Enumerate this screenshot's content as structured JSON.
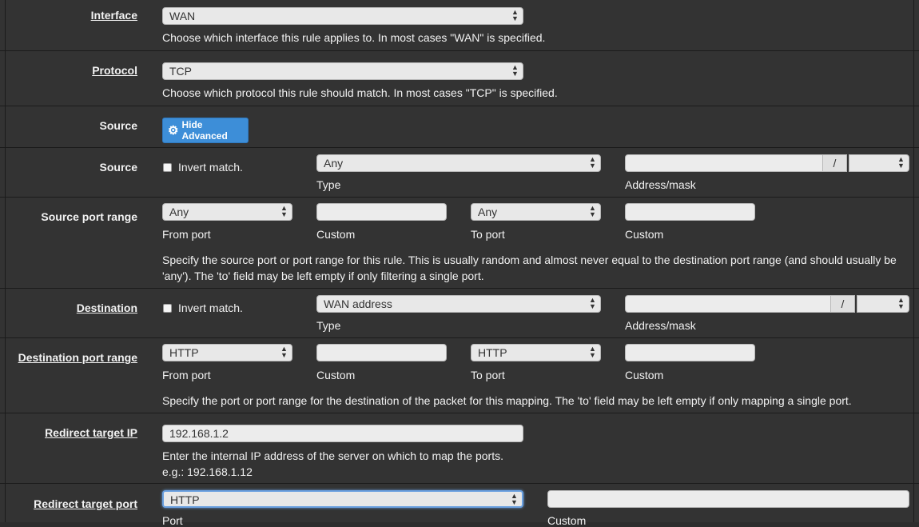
{
  "interface": {
    "label": "Interface",
    "value": "WAN",
    "help": "Choose which interface this rule applies to. In most cases \"WAN\" is specified."
  },
  "protocol": {
    "label": "Protocol",
    "value": "TCP",
    "help": "Choose which protocol this rule should match. In most cases \"TCP\" is specified."
  },
  "source_advanced": {
    "label": "Source",
    "button_label": "Hide Advanced",
    "button_icon": "gear-icon"
  },
  "source": {
    "label": "Source",
    "invert_label": "Invert match.",
    "invert_checked": false,
    "type_value": "Any",
    "type_label": "Type",
    "address_value": "",
    "slash": "/",
    "mask_value": "",
    "address_label": "Address/mask"
  },
  "source_port_range": {
    "label": "Source port range",
    "from_value": "Any",
    "from_label": "From port",
    "from_custom_value": "",
    "from_custom_label": "Custom",
    "to_value": "Any",
    "to_label": "To port",
    "to_custom_value": "",
    "to_custom_label": "Custom",
    "help": "Specify the source port or port range for this rule. This is usually random and almost never equal to the destination port range (and should usually be 'any'). The 'to' field may be left empty if only filtering a single port."
  },
  "destination": {
    "label": "Destination",
    "invert_label": "Invert match.",
    "invert_checked": false,
    "type_value": "WAN address",
    "type_label": "Type",
    "address_value": "",
    "slash": "/",
    "mask_value": "",
    "address_label": "Address/mask"
  },
  "destination_port_range": {
    "label": "Destination port range",
    "from_value": "HTTP",
    "from_label": "From port",
    "from_custom_value": "",
    "from_custom_label": "Custom",
    "to_value": "HTTP",
    "to_label": "To port",
    "to_custom_value": "",
    "to_custom_label": "Custom",
    "help": "Specify the port or port range for the destination of the packet for this mapping. The 'to' field may be left empty if only mapping a single port."
  },
  "redirect_target_ip": {
    "label": "Redirect target IP",
    "value": "192.168.1.2",
    "help": "Enter the internal IP address of the server on which to map the ports.",
    "example": "e.g.: 192.168.1.12"
  },
  "redirect_target_port": {
    "label": "Redirect target port",
    "value": "HTTP",
    "custom_value": "",
    "port_label": "Port",
    "custom_label": "Custom"
  },
  "colors": {
    "background": "#333333",
    "button": "#3d8ed8",
    "focus": "#6aa0e0"
  }
}
